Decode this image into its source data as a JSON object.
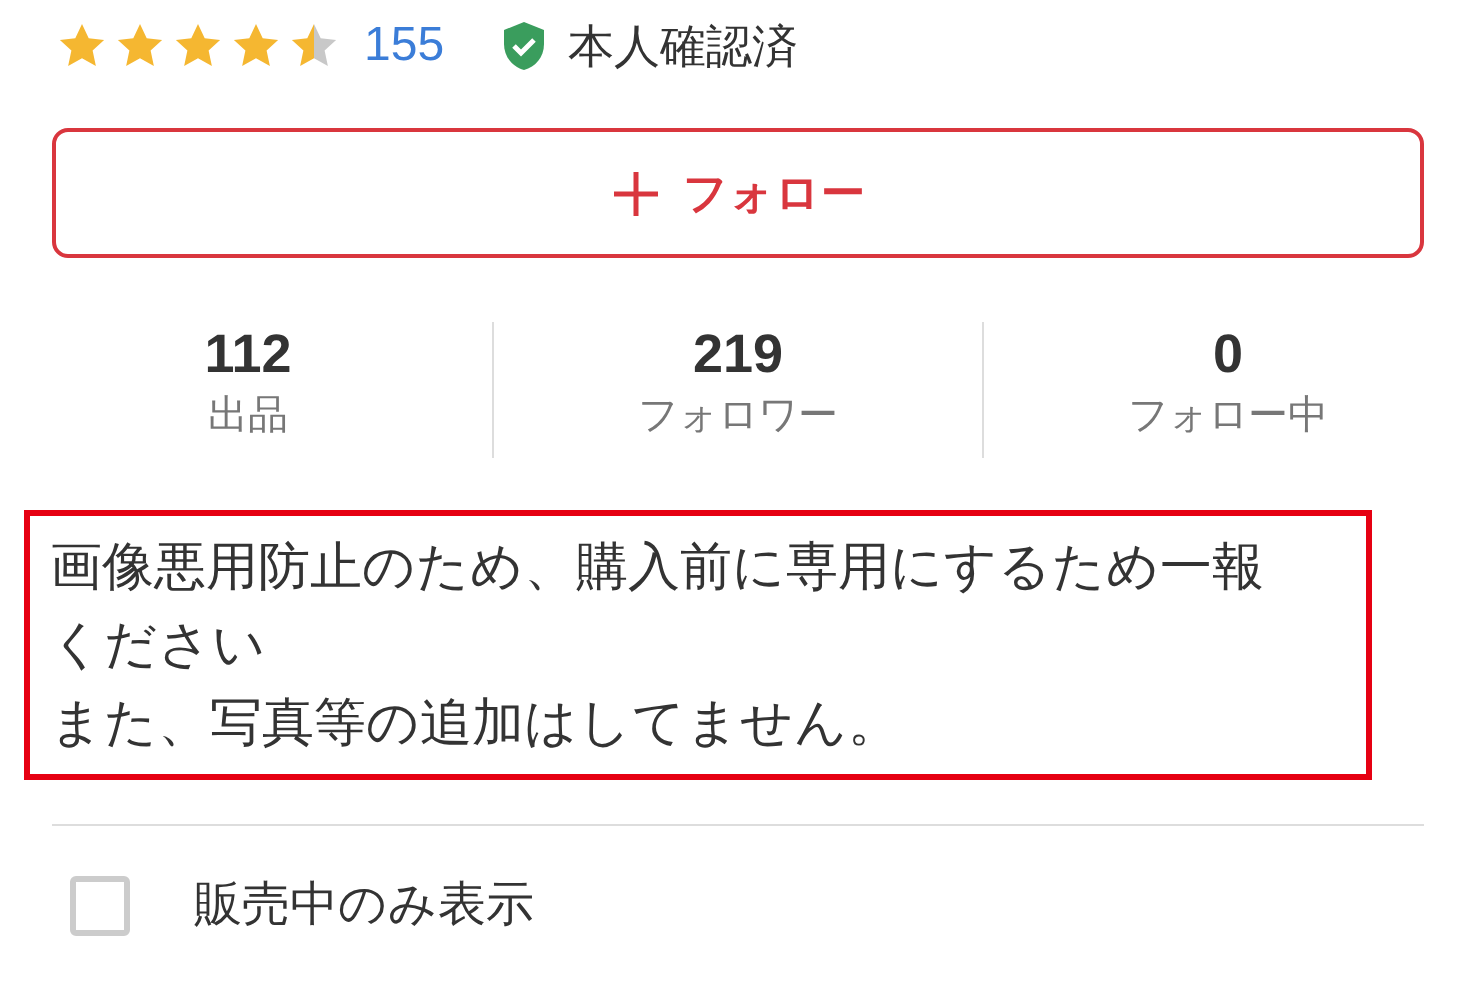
{
  "rating": {
    "stars": 4.5,
    "count": "155"
  },
  "verified": {
    "label": "本人確認済"
  },
  "follow_button": {
    "label": "フォロー"
  },
  "stats": [
    {
      "value": "112",
      "label": "出品"
    },
    {
      "value": "219",
      "label": "フォロワー"
    },
    {
      "value": "0",
      "label": "フォロー中"
    }
  ],
  "description": {
    "lines": [
      "画像悪用防止のため、購入前に専用にするため一報",
      "ください",
      "また、写真等の追加はしてません。"
    ]
  },
  "filter": {
    "label": "販売中のみ表示",
    "checked": false
  }
}
